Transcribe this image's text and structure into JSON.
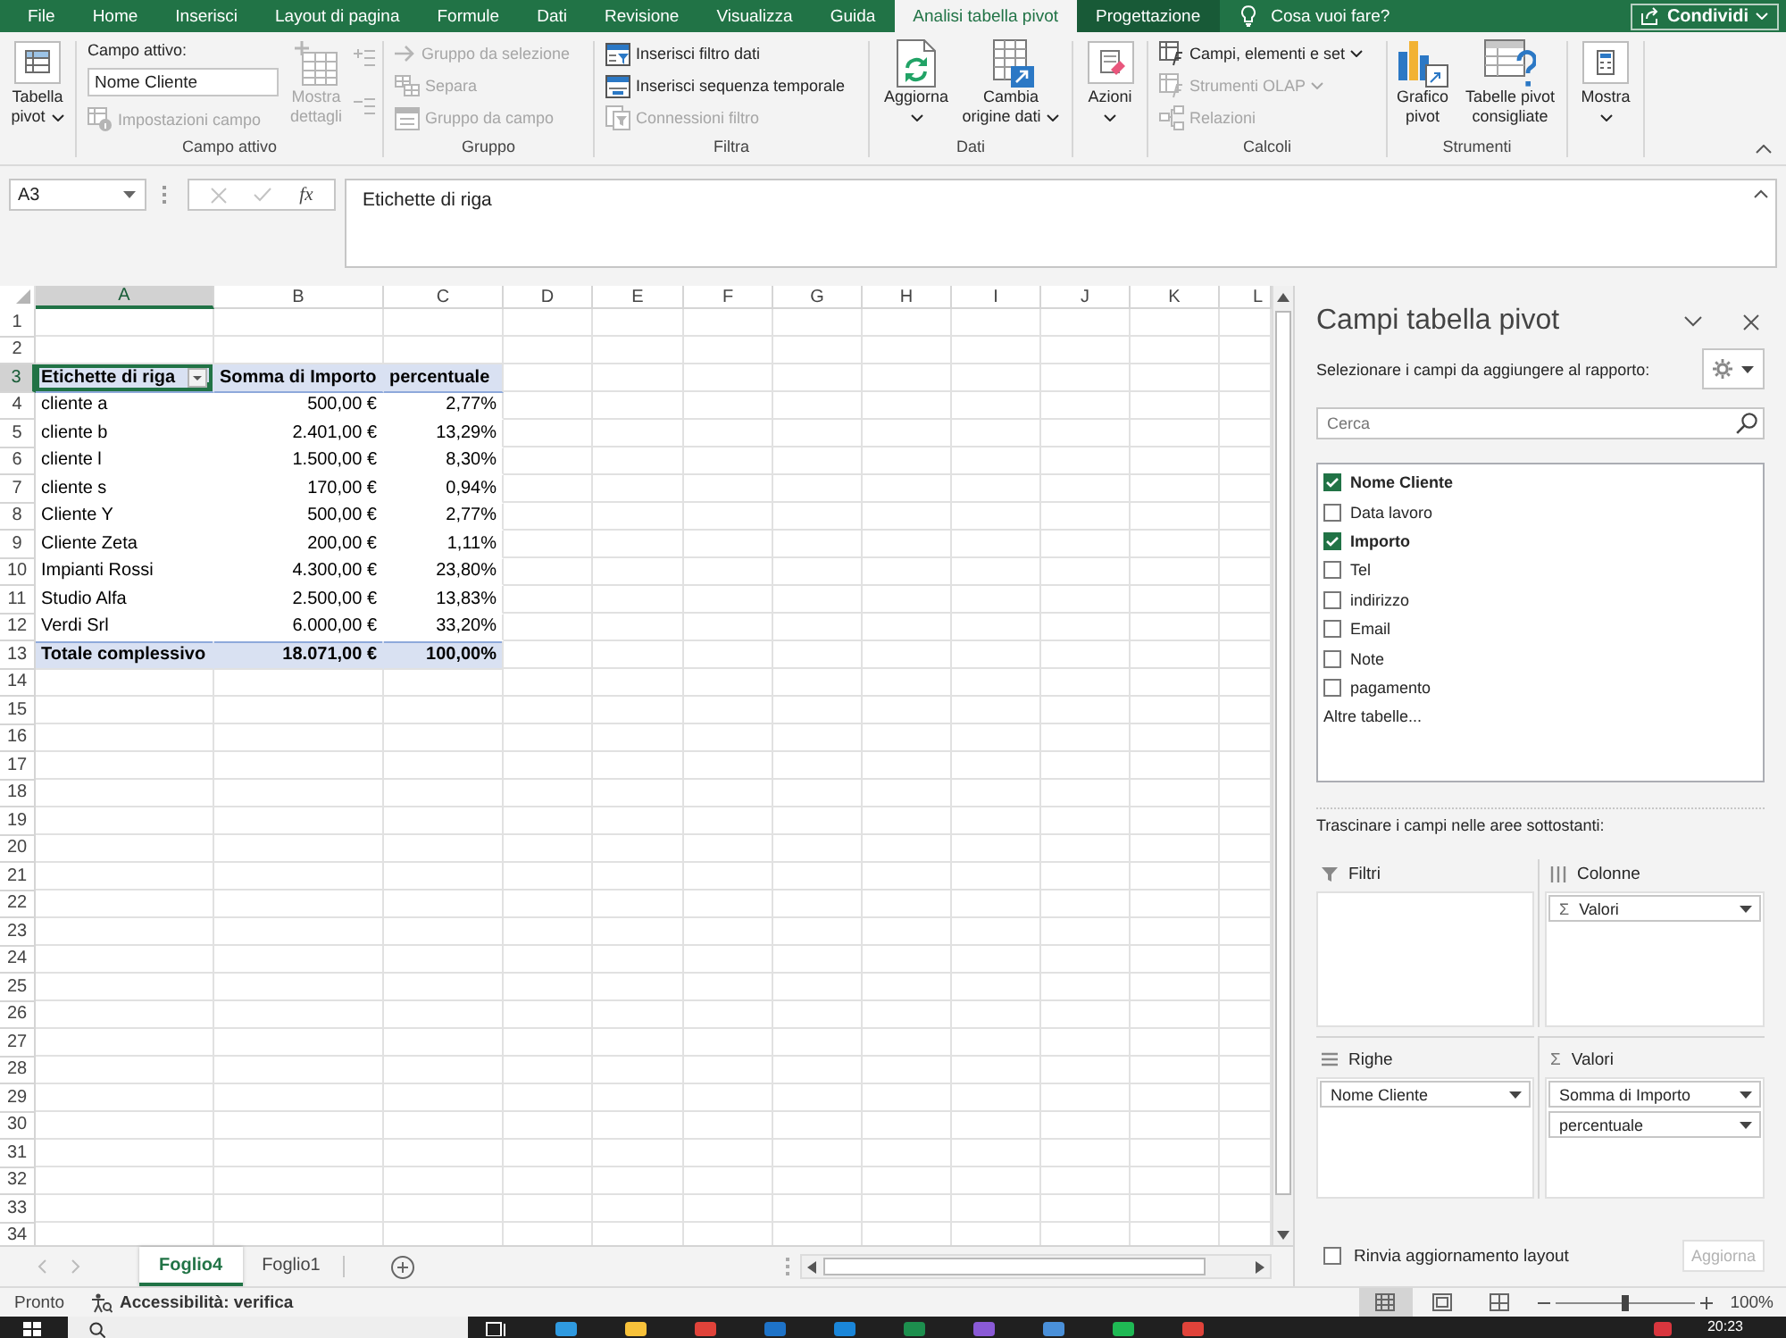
{
  "ribbon_tabs": [
    {
      "label": "File",
      "selected": false,
      "contextual": false
    },
    {
      "label": "Home",
      "selected": false,
      "contextual": false
    },
    {
      "label": "Inserisci",
      "selected": false,
      "contextual": false
    },
    {
      "label": "Layout di pagina",
      "selected": false,
      "contextual": false
    },
    {
      "label": "Formule",
      "selected": false,
      "contextual": false
    },
    {
      "label": "Dati",
      "selected": false,
      "contextual": false
    },
    {
      "label": "Revisione",
      "selected": false,
      "contextual": false
    },
    {
      "label": "Visualizza",
      "selected": false,
      "contextual": false
    },
    {
      "label": "Guida",
      "selected": false,
      "contextual": false
    },
    {
      "label": "Analisi tabella pivot",
      "selected": true,
      "contextual": true
    },
    {
      "label": "Progettazione",
      "selected": false,
      "contextual": true
    }
  ],
  "tell_me": "Cosa vuoi fare?",
  "share_button": "Condividi",
  "ribbon": {
    "groups": [
      {
        "columns": [
          [
            {
              "kind": "large",
              "label": "Tabella pivot",
              "dropdown": true,
              "disabled": false
            }
          ]
        ]
      },
      {
        "label": "Campo attivo",
        "columns": [
          [
            {
              "kind": "field",
              "label": "Campo attivo:",
              "value": "Nome Cliente"
            },
            {
              "kind": "small",
              "label": "Impostazioni campo",
              "dropdown": false,
              "disabled": true
            }
          ],
          [
            {
              "kind": "large",
              "label": "Mostra dettagli",
              "dropdown": false,
              "disabled": true
            }
          ],
          [
            {
              "kind": "icon",
              "disabled": true
            },
            {
              "kind": "icon",
              "disabled": true
            }
          ]
        ]
      },
      {
        "label": "Gruppo",
        "columns": [
          [
            {
              "kind": "small",
              "label": "Gruppo da selezione",
              "dropdown": false,
              "disabled": true
            },
            {
              "kind": "small",
              "label": "Separa",
              "dropdown": false,
              "disabled": true
            },
            {
              "kind": "small",
              "label": "Gruppo da campo",
              "dropdown": false,
              "disabled": true
            }
          ]
        ]
      },
      {
        "label": "Filtra",
        "columns": [
          [
            {
              "kind": "small",
              "label": "Inserisci filtro dati",
              "dropdown": false,
              "disabled": false
            },
            {
              "kind": "small",
              "label": "Inserisci sequenza temporale",
              "dropdown": false,
              "disabled": false
            },
            {
              "kind": "small",
              "label": "Connessioni filtro",
              "dropdown": false,
              "disabled": true
            }
          ]
        ]
      },
      {
        "label": "Dati",
        "columns": [
          [
            {
              "kind": "large",
              "label": "Aggiorna",
              "dropdown": true,
              "disabled": false
            }
          ],
          [
            {
              "kind": "large",
              "label": "Cambia origine dati",
              "dropdown": true,
              "disabled": false
            }
          ]
        ]
      },
      {
        "columns": [
          [
            {
              "kind": "large",
              "label": "Azioni",
              "dropdown": true,
              "disabled": false
            }
          ]
        ]
      },
      {
        "label": "Calcoli",
        "columns": [
          [
            {
              "kind": "small",
              "label": "Campi, elementi e set",
              "dropdown": true,
              "disabled": false
            },
            {
              "kind": "small",
              "label": "Strumenti OLAP",
              "dropdown": true,
              "disabled": true
            },
            {
              "kind": "small",
              "label": "Relazioni",
              "dropdown": false,
              "disabled": true
            }
          ]
        ]
      },
      {
        "label": "Strumenti",
        "columns": [
          [
            {
              "kind": "large",
              "label": "Grafico pivot",
              "dropdown": false,
              "disabled": false
            }
          ],
          [
            {
              "kind": "large",
              "label": "Tabelle pivot consigliate",
              "dropdown": false,
              "disabled": false
            }
          ]
        ]
      },
      {
        "columns": [
          [
            {
              "kind": "large",
              "label": "Mostra",
              "dropdown": true,
              "disabled": false
            }
          ]
        ]
      }
    ]
  },
  "formula_bar": {
    "name_box": "A3",
    "function_button": "fx",
    "formula": "Etichette di riga"
  },
  "sheet": {
    "columns": [
      {
        "label": "A",
        "selected": true
      },
      {
        "label": "B",
        "selected": false
      },
      {
        "label": "C",
        "selected": false
      },
      {
        "label": "D",
        "selected": false
      },
      {
        "label": "E",
        "selected": false
      },
      {
        "label": "F",
        "selected": false
      },
      {
        "label": "G",
        "selected": false
      },
      {
        "label": "H",
        "selected": false
      },
      {
        "label": "I",
        "selected": false
      },
      {
        "label": "J",
        "selected": false
      },
      {
        "label": "K",
        "selected": false
      },
      {
        "label": "L",
        "selected": false
      }
    ],
    "rows": [
      {
        "number": "1",
        "selected": false,
        "kind": "empty"
      },
      {
        "number": "2",
        "selected": false,
        "kind": "empty"
      },
      {
        "number": "3",
        "selected": true,
        "kind": "header",
        "cells": [
          {
            "text": "Etichette di riga",
            "selected": true
          },
          {
            "text": "Somma di Importo",
            "selected": false
          },
          {
            "text": "percentuale",
            "selected": false
          }
        ]
      },
      {
        "number": "4",
        "selected": false,
        "kind": "item",
        "cells": [
          {
            "text": "cliente a",
            "selected": false
          },
          {
            "text": "500,00 €",
            "selected": false
          },
          {
            "text": "2,77%",
            "selected": false
          }
        ]
      },
      {
        "number": "5",
        "selected": false,
        "kind": "item",
        "cells": [
          {
            "text": "cliente b",
            "selected": false
          },
          {
            "text": "2.401,00 €",
            "selected": false
          },
          {
            "text": "13,29%",
            "selected": false
          }
        ]
      },
      {
        "number": "6",
        "selected": false,
        "kind": "item",
        "cells": [
          {
            "text": "cliente l",
            "selected": false
          },
          {
            "text": "1.500,00 €",
            "selected": false
          },
          {
            "text": "8,30%",
            "selected": false
          }
        ]
      },
      {
        "number": "7",
        "selected": false,
        "kind": "item",
        "cells": [
          {
            "text": "cliente s",
            "selected": false
          },
          {
            "text": "170,00 €",
            "selected": false
          },
          {
            "text": "0,94%",
            "selected": false
          }
        ]
      },
      {
        "number": "8",
        "selected": false,
        "kind": "item",
        "cells": [
          {
            "text": "Cliente Y",
            "selected": false
          },
          {
            "text": "500,00 €",
            "selected": false
          },
          {
            "text": "2,77%",
            "selected": false
          }
        ]
      },
      {
        "number": "9",
        "selected": false,
        "kind": "item",
        "cells": [
          {
            "text": "Cliente Zeta",
            "selected": false
          },
          {
            "text": "200,00 €",
            "selected": false
          },
          {
            "text": "1,11%",
            "selected": false
          }
        ]
      },
      {
        "number": "10",
        "selected": false,
        "kind": "item",
        "cells": [
          {
            "text": "Impianti Rossi",
            "selected": false
          },
          {
            "text": "4.300,00 €",
            "selected": false
          },
          {
            "text": "23,80%",
            "selected": false
          }
        ]
      },
      {
        "number": "11",
        "selected": false,
        "kind": "item",
        "cells": [
          {
            "text": "Studio Alfa",
            "selected": false
          },
          {
            "text": "2.500,00 €",
            "selected": false
          },
          {
            "text": "13,83%",
            "selected": false
          }
        ]
      },
      {
        "number": "12",
        "selected": false,
        "kind": "item",
        "cells": [
          {
            "text": "Verdi Srl",
            "selected": false
          },
          {
            "text": "6.000,00 €",
            "selected": false
          },
          {
            "text": "33,20%",
            "selected": false
          }
        ]
      },
      {
        "number": "13",
        "selected": false,
        "kind": "total",
        "cells": [
          {
            "text": "Totale complessivo",
            "selected": false
          },
          {
            "text": "18.071,00 €",
            "selected": false
          },
          {
            "text": "100,00%",
            "selected": false
          }
        ]
      },
      {
        "number": "14",
        "selected": false,
        "kind": "empty"
      },
      {
        "number": "15",
        "selected": false,
        "kind": "empty"
      },
      {
        "number": "16",
        "selected": false,
        "kind": "empty"
      },
      {
        "number": "17",
        "selected": false,
        "kind": "empty"
      },
      {
        "number": "18",
        "selected": false,
        "kind": "empty"
      },
      {
        "number": "19",
        "selected": false,
        "kind": "empty"
      },
      {
        "number": "20",
        "selected": false,
        "kind": "empty"
      },
      {
        "number": "21",
        "selected": false,
        "kind": "empty"
      },
      {
        "number": "22",
        "selected": false,
        "kind": "empty"
      },
      {
        "number": "23",
        "selected": false,
        "kind": "empty"
      },
      {
        "number": "24",
        "selected": false,
        "kind": "empty"
      },
      {
        "number": "25",
        "selected": false,
        "kind": "empty"
      },
      {
        "number": "26",
        "selected": false,
        "kind": "empty"
      },
      {
        "number": "27",
        "selected": false,
        "kind": "empty"
      },
      {
        "number": "28",
        "selected": false,
        "kind": "empty"
      },
      {
        "number": "29",
        "selected": false,
        "kind": "empty"
      },
      {
        "number": "30",
        "selected": false,
        "kind": "empty"
      },
      {
        "number": "31",
        "selected": false,
        "kind": "empty"
      },
      {
        "number": "32",
        "selected": false,
        "kind": "empty"
      },
      {
        "number": "33",
        "selected": false,
        "kind": "empty"
      },
      {
        "number": "34",
        "selected": false,
        "kind": "empty"
      }
    ]
  },
  "sheet_tabs": [
    {
      "label": "Foglio4",
      "selected": true
    },
    {
      "label": "Foglio1",
      "selected": false
    }
  ],
  "pivot_panel": {
    "title": "Campi tabella pivot",
    "instruction": "Selezionare i campi da aggiungere al rapporto:",
    "search": {
      "placeholder": "Cerca"
    },
    "fields": [
      {
        "label": "Nome Cliente",
        "checked": true
      },
      {
        "label": "Data lavoro",
        "checked": false
      },
      {
        "label": "Importo",
        "checked": true
      },
      {
        "label": "Tel",
        "checked": false
      },
      {
        "label": "indirizzo",
        "checked": false
      },
      {
        "label": "Email",
        "checked": false
      },
      {
        "label": "Note",
        "checked": false
      },
      {
        "label": "pagamento",
        "checked": false
      }
    ],
    "more_tables": "Altre tabelle...",
    "areas_instruction": "Trascinare i campi nelle aree sottostanti:",
    "areas": [
      {
        "kind": "filters",
        "title": "Filtri"
      },
      {
        "kind": "columns",
        "title": "Colonne",
        "items": [
          {
            "symbol": "Σ",
            "label": "Valori"
          }
        ]
      },
      {
        "kind": "rows",
        "title": "Righe",
        "items": [
          {
            "label": "Nome Cliente"
          }
        ]
      },
      {
        "kind": "values",
        "symbol": "Σ",
        "title": "Valori",
        "items": [
          {
            "label": "Somma di Importo"
          },
          {
            "label": "percentuale"
          }
        ]
      }
    ],
    "defer_update": {
      "label": "Rinvia aggiornamento layout",
      "checked": false
    },
    "update_button": {
      "label": "Aggiorna",
      "disabled": true
    }
  },
  "status_bar": {
    "status": "Pronto",
    "accessibility": "Accessibilità: verifica",
    "views": [
      {
        "kind": "normal",
        "selected": true
      },
      {
        "kind": "page_layout",
        "selected": false
      },
      {
        "kind": "page_break",
        "selected": false
      }
    ],
    "zoom": {
      "level": 0.5,
      "reading": "100%"
    }
  },
  "taskbar": {
    "clock": "20:23"
  }
}
